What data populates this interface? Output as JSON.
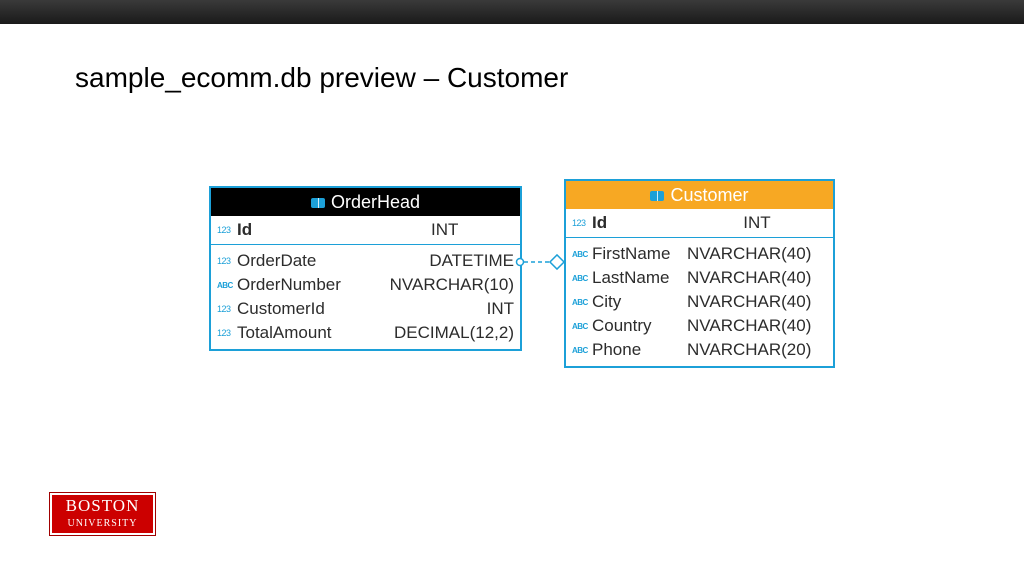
{
  "title": "sample_ecomm.db preview – Customer",
  "tables": {
    "a": {
      "name": "OrderHead",
      "pk": {
        "icon": "num",
        "name": "Id",
        "type": "INT"
      },
      "cols": [
        {
          "icon": "num",
          "name": "OrderDate",
          "type": "DATETIME"
        },
        {
          "icon": "str",
          "name": "OrderNumber",
          "type": "NVARCHAR(10)"
        },
        {
          "icon": "num",
          "name": "CustomerId",
          "type": "INT"
        },
        {
          "icon": "num",
          "name": "TotalAmount",
          "type": "DECIMAL(12,2)"
        }
      ]
    },
    "b": {
      "name": "Customer",
      "pk": {
        "icon": "num",
        "name": "Id",
        "type": "INT"
      },
      "cols": [
        {
          "icon": "str",
          "name": "FirstName",
          "type": "NVARCHAR(40)"
        },
        {
          "icon": "str",
          "name": "LastName",
          "type": "NVARCHAR(40)"
        },
        {
          "icon": "str",
          "name": "City",
          "type": "NVARCHAR(40)"
        },
        {
          "icon": "str",
          "name": "Country",
          "type": "NVARCHAR(40)"
        },
        {
          "icon": "str",
          "name": "Phone",
          "type": "NVARCHAR(20)"
        }
      ]
    }
  },
  "logo": {
    "line1": "BOSTON",
    "line2": "UNIVERSITY"
  }
}
